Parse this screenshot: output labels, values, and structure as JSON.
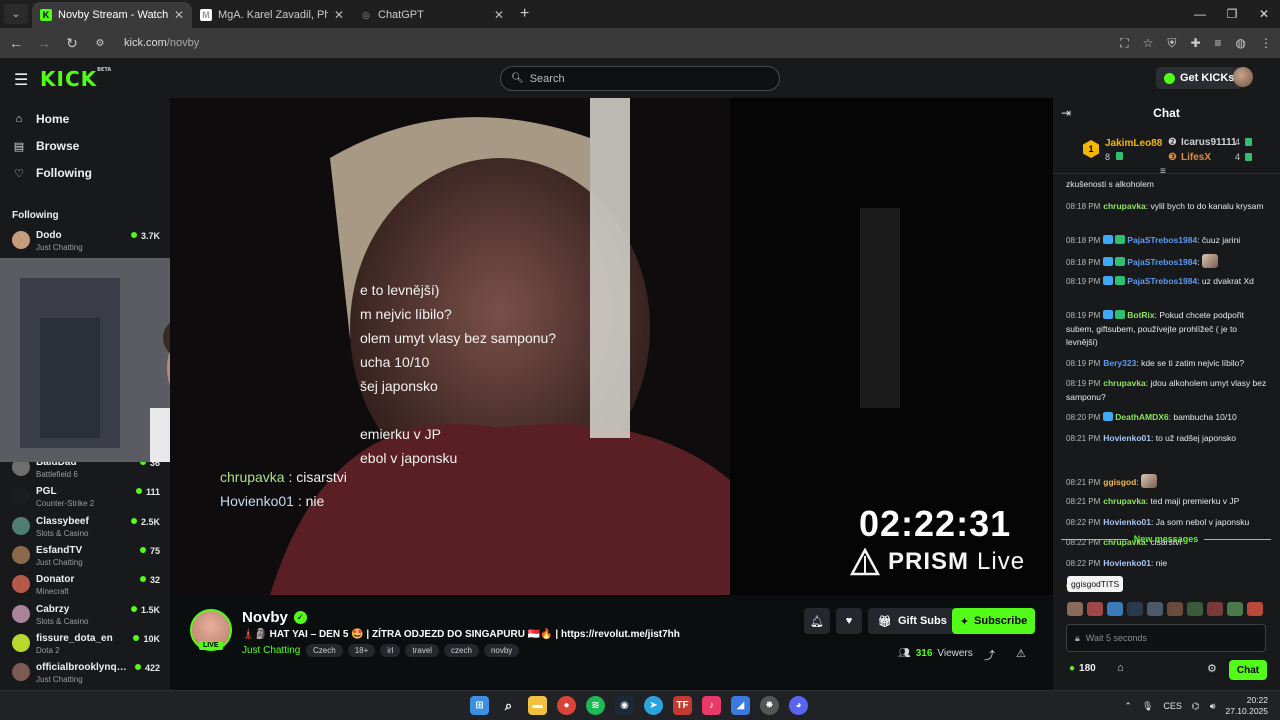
{
  "browser": {
    "tabs": [
      {
        "title": "Novby Stream - Watch Live",
        "fav": "#53fc18",
        "favtext": "K",
        "active": true
      },
      {
        "title": "MgA. Karel Zavadil, Ph.D.",
        "fav": "#ffffff",
        "favtext": "M",
        "active": false
      },
      {
        "title": "ChatGPT",
        "fav": "#1f1f1f",
        "favtext": "◎",
        "active": false
      }
    ],
    "url_host": "kick.com",
    "url_path": "/novby"
  },
  "header": {
    "logo": "KICK",
    "logo_badge": "BETA",
    "search_placeholder": "Search",
    "get_kicks_label": "Get KICKs"
  },
  "sidebar": {
    "nav": [
      {
        "label": "Home",
        "icon": "⌂"
      },
      {
        "label": "Browse",
        "icon": "▤"
      },
      {
        "label": "Following",
        "icon": "♡"
      }
    ],
    "following_title": "Following",
    "channels_top": [
      {
        "name": "Dodo",
        "category": "Just Chatting",
        "viewers": "3.7K",
        "color": "#c69c7d"
      }
    ],
    "channels": [
      {
        "name": "BaldDad",
        "category": "Battlefield 6",
        "viewers": "36",
        "color": "#6e6e6e"
      },
      {
        "name": "PGL",
        "category": "Counter-Strike 2",
        "viewers": "111",
        "color": "#1d1d1d"
      },
      {
        "name": "Classybeef",
        "category": "Slots & Casino",
        "viewers": "2.5K",
        "color": "#4f7e70"
      },
      {
        "name": "EsfandTV",
        "category": "Just Chatting",
        "viewers": "75",
        "color": "#8a6a4a"
      },
      {
        "name": "Donator",
        "category": "Minecraft",
        "viewers": "32",
        "color": "#b55a4a"
      },
      {
        "name": "Cabrzy",
        "category": "Slots & Casino",
        "viewers": "1.5K",
        "color": "#a8839a"
      },
      {
        "name": "fissure_dota_en",
        "category": "Dota 2",
        "viewers": "10K",
        "color": "#b8d830"
      },
      {
        "name": "officialbrooklynqu...",
        "category": "Just Chatting",
        "viewers": "422",
        "color": "#7a5a52"
      }
    ]
  },
  "video": {
    "overlay_lines": [
      "e to levnější)",
      "m nejvic líbilo?",
      "olem umyt vlasy bez samponu?",
      "ucha 10/10",
      "šej japonsko",
      "",
      "emierku v JP",
      "ebol v japonsku"
    ],
    "overlay_chat": [
      {
        "user": "chrupavka",
        "text": " : cisarstvi"
      },
      {
        "user": "Hovienko01",
        "text": " : nie"
      }
    ],
    "timer": "02:22:31",
    "prism_brand": "PRISM",
    "prism_live": "Live"
  },
  "stream": {
    "streamer": "Novby",
    "live_badge": "LIVE",
    "title": "🗼🗿 HAT YAI – DEN 5 🤩 | ZÍTRA ODJEZD DO SINGAPURU 🇸🇬🔥 | https://revolut.me/jist7hh",
    "category": "Just Chatting",
    "tags": [
      "Czech",
      "18+",
      "irl",
      "travel",
      "czech",
      "novby"
    ],
    "gift_label": "Gift Subs",
    "subscribe_label": "Subscribe",
    "viewers_count": "316",
    "viewers_label": "Viewers"
  },
  "chat": {
    "title": "Chat",
    "leaderboard": {
      "first": {
        "rank": "1",
        "name": "JakimLeo88",
        "count": "8"
      },
      "second": {
        "name": "Icarus91111",
        "count": "4"
      },
      "third": {
        "name": "LifesX",
        "count": "4"
      }
    },
    "messages": [
      {
        "time": "",
        "user": "",
        "color": "#ffffff",
        "badges": 0,
        "text": "zkušenosti s alkoholem"
      },
      {
        "time": "08:18 PM",
        "user": "chrupavka",
        "color": "#8fe35b",
        "badges": 0,
        "text": "vylil bych to do kanalu krysam"
      },
      {
        "time": "08:18 PM",
        "user": "PajaSTrebos1984",
        "color": "#5c9cf0",
        "badges": 2,
        "text": "čuuz jarini"
      },
      {
        "time": "08:18 PM",
        "user": "PajaSTrebos1984",
        "color": "#5c9cf0",
        "badges": 2,
        "text": ""
      },
      {
        "time": "08:19 PM",
        "user": "PajaSTrebos1984",
        "color": "#5c9cf0",
        "badges": 2,
        "text": "uz dvakrat Xd"
      },
      {
        "time": "08:19 PM",
        "user": "BotRix",
        "color": "#8fe35b",
        "badges": 2,
        "text": "Pokud chcete podpořit subem, giftsubem, používejte prohlížeč ( je to levnější)"
      },
      {
        "time": "08:19 PM",
        "user": "Bery323",
        "color": "#5c9cf0",
        "badges": 0,
        "text": "kde se ti zatim nejvic líbilo?"
      },
      {
        "time": "08:19 PM",
        "user": "chrupavka",
        "color": "#8fe35b",
        "badges": 0,
        "text": "jdou alkoholem umyt vlasy bez samponu?"
      },
      {
        "time": "08:20 PM",
        "user": "DeathAMDX6",
        "color": "#8fe35b",
        "badges": 1,
        "text": "bambucha 10/10"
      },
      {
        "time": "08:21 PM",
        "user": "Hovienko01",
        "color": "#a9c6f5",
        "badges": 0,
        "text": "to už radšej japonsko"
      }
    ],
    "new_messages_label": "New messages",
    "messages_new": [
      {
        "time": "08:21 PM",
        "user": "ggisgod",
        "color": "#f0b94a",
        "text": ""
      },
      {
        "time": "08:21 PM",
        "user": "chrupavka",
        "color": "#8fe35b",
        "text": "ted maji premierku v JP"
      },
      {
        "time": "08:22 PM",
        "user": "Hovienko01",
        "color": "#a9c6f5",
        "text": "Ja som nebol v japonsku"
      },
      {
        "time": "08:22 PM",
        "user": "chrupavka",
        "color": "#8fe35b",
        "text": "cisarstvi"
      },
      {
        "time": "08:22 PM",
        "user": "Hovienko01",
        "color": "#a9c6f5",
        "text": "nie"
      },
      {
        "time": "",
        "user": "od",
        "color": "#f0b94a",
        "text": ""
      }
    ],
    "tooltip": "ggisgodTITS",
    "input_placeholder": "Wait 5 seconds",
    "points": "180",
    "chat_button": "Chat"
  },
  "taskbar": {
    "lang": "CES",
    "time": "20:22",
    "date": "27.10.2025"
  },
  "colors": {
    "accent": "#53fc18",
    "bg": "#0b0e0f",
    "panel": "#18191b"
  }
}
